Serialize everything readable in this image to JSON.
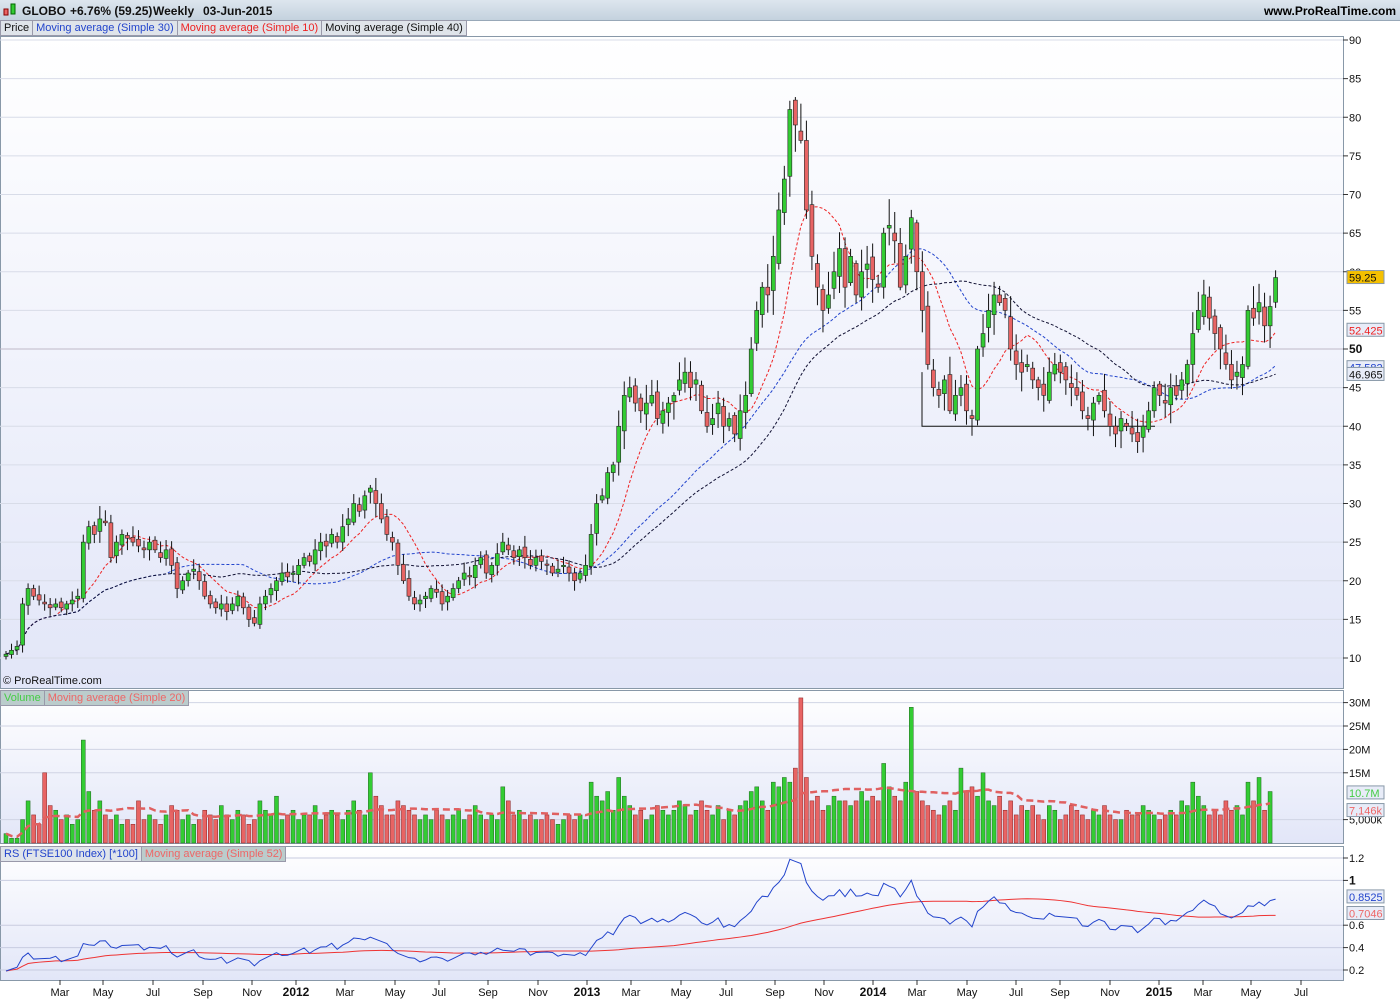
{
  "header": {
    "symbol": "GLOBO",
    "change": "+6.76% (59.25)",
    "period": "Weekly",
    "date": "03-Jun-2015",
    "site": "www.ProRealTime.com"
  },
  "legend_price": [
    "Price",
    "Moving average (Simple 30)",
    "Moving average (Simple 10)",
    "Moving average (Simple 40)"
  ],
  "legend_volume": [
    "Volume",
    "Moving average (Simple 20)"
  ],
  "legend_rs": [
    "RS (FTSE100 Index) [*100]",
    "Moving average (Simple 52)"
  ],
  "copyright": "© ProRealTime.com",
  "colors": {
    "up": "#33cc33",
    "down": "#e86464",
    "ma30": "#2244cc",
    "ma10": "#ee2222",
    "ma40": "#111133",
    "rs": "#2244cc",
    "rsma": "#ee3333"
  },
  "chart_data": [
    {
      "type": "candlestick",
      "title": "GLOBO Weekly",
      "ylim": [
        8,
        92
      ],
      "yticks": [
        10,
        15,
        20,
        25,
        30,
        35,
        40,
        45,
        50,
        55,
        60,
        65,
        70,
        75,
        80,
        85,
        90
      ],
      "closes": [
        10.5,
        11,
        11.5,
        17,
        19,
        18,
        17.5,
        17,
        16.5,
        17,
        16.5,
        17,
        17.5,
        18,
        25,
        27,
        26,
        28,
        27.5,
        23,
        25,
        26,
        25.5,
        25,
        24.5,
        24,
        25,
        24,
        23,
        24,
        22,
        19,
        20,
        21,
        21.5,
        20,
        18,
        17,
        16.5,
        17,
        16,
        17,
        18,
        16.5,
        15,
        14.5,
        17,
        18,
        19,
        20,
        21,
        20.5,
        21,
        22,
        23,
        22.5,
        24,
        25,
        24.5,
        26,
        25,
        27,
        28,
        30,
        29,
        31,
        32,
        30,
        28,
        26,
        25,
        22,
        20,
        18,
        17,
        17.5,
        18,
        19,
        18.5,
        17,
        18,
        19,
        20,
        21,
        20.5,
        22,
        23,
        21,
        22,
        23.5,
        25,
        24,
        23,
        24,
        23,
        22,
        23,
        22.5,
        22,
        21,
        21.5,
        22,
        21,
        20,
        21,
        22,
        26,
        30,
        31,
        34,
        35,
        40,
        44,
        45,
        43,
        42,
        43,
        44,
        41,
        42,
        43,
        44,
        46,
        47,
        45,
        46,
        42,
        40,
        41,
        43,
        40,
        41,
        39,
        42,
        44,
        50,
        55,
        58,
        57,
        62,
        68,
        72,
        81,
        79,
        77,
        68,
        62,
        58,
        55,
        57,
        60,
        63,
        58,
        62,
        57,
        60,
        61,
        59,
        58,
        65,
        66,
        64,
        58,
        62,
        67,
        60,
        55,
        48,
        45,
        44,
        46,
        42,
        44,
        45,
        42,
        41,
        50,
        52,
        55,
        57,
        56,
        55,
        50,
        48,
        47,
        48,
        46,
        45,
        44,
        47,
        48,
        47,
        46,
        45,
        44,
        42,
        41,
        43,
        44,
        42,
        40,
        39,
        41,
        40,
        39,
        38,
        40,
        42,
        45,
        44,
        43,
        45,
        44,
        46,
        48,
        52,
        55,
        57,
        54,
        52,
        50,
        48,
        46,
        47,
        48,
        55,
        54,
        56,
        53,
        55.5,
        59.25
      ],
      "last_labels": {
        "price": "59.25",
        "ma10": "52.425",
        "ma30": "47.582",
        "ma40": "46.965"
      },
      "support_level": 40
    },
    {
      "type": "bar",
      "title": "Volume",
      "yticks": [
        "5,000k",
        "15M",
        "20M",
        "25M",
        "30M"
      ],
      "ytick_values": [
        5,
        15,
        20,
        25,
        30
      ],
      "volumes_millions": [
        2,
        1,
        1,
        5,
        9,
        6,
        4,
        15,
        8,
        7,
        5,
        6,
        4,
        5,
        22,
        11,
        7,
        9,
        6,
        5,
        6,
        4,
        5,
        4,
        9,
        5,
        6,
        5,
        4,
        6,
        8,
        7,
        5,
        6,
        4,
        5,
        7,
        6,
        5,
        8,
        6,
        5,
        7,
        6,
        4,
        5,
        9,
        7,
        6,
        10,
        5,
        6,
        7,
        5,
        6,
        6,
        8,
        5,
        6,
        7,
        6,
        5,
        7,
        9,
        7,
        6,
        15,
        10,
        8,
        6,
        6,
        9,
        8,
        7,
        6,
        5,
        6,
        5,
        7,
        6,
        5,
        6,
        7,
        5,
        6,
        8,
        6,
        5,
        6,
        5,
        12,
        9,
        6,
        7,
        5,
        6,
        5,
        5,
        6,
        5,
        4,
        5,
        6,
        5,
        6,
        5,
        13,
        10,
        9,
        11,
        7,
        14,
        10,
        8,
        6,
        7,
        5,
        6,
        8,
        7,
        6,
        7,
        9,
        8,
        6,
        7,
        9,
        7,
        6,
        8,
        5,
        7,
        6,
        8,
        9,
        11,
        12,
        9,
        7,
        13,
        12,
        14,
        13,
        16,
        31,
        14,
        9,
        10,
        7,
        8,
        10,
        9,
        9,
        8,
        9,
        11,
        9,
        10,
        9,
        17,
        12,
        10,
        9,
        13,
        29,
        11,
        9,
        8,
        7,
        6,
        8,
        9,
        7,
        16,
        11,
        12,
        10,
        15,
        9,
        8,
        10,
        7,
        9,
        6,
        8,
        7,
        8,
        6,
        5,
        8,
        7,
        5,
        6,
        8,
        7,
        6,
        5,
        7,
        6,
        8,
        6,
        5,
        5,
        7,
        6,
        6,
        8,
        7,
        6,
        5,
        6,
        7,
        6,
        9,
        8,
        13,
        10,
        8,
        6,
        7,
        6,
        9,
        7,
        8,
        6,
        13,
        9,
        14,
        7,
        11
      ],
      "last_labels": {
        "volume": "10.7M",
        "ma20": "7,146k"
      }
    },
    {
      "type": "line",
      "title": "RS (FTSE100 Index) [*100]",
      "yticks": [
        "0.2",
        "0.4",
        "0.6",
        "1",
        "1.2"
      ],
      "ytick_values": [
        0.2,
        0.4,
        0.6,
        1,
        1.2
      ],
      "last_labels": {
        "rs": "0.8525",
        "ma52": "0.7046"
      }
    }
  ],
  "xaxis": {
    "labels": [
      "Mar",
      "May",
      "Jul",
      "Sep",
      "Nov",
      "2012",
      "Mar",
      "May",
      "Jul",
      "Sep",
      "Nov",
      "2013",
      "Mar",
      "May",
      "Jul",
      "Sep",
      "Nov",
      "2014",
      "Mar",
      "May",
      "Jul",
      "Sep",
      "Nov",
      "2015",
      "Mar",
      "May",
      "Jul"
    ],
    "bold": [
      "2012",
      "2013",
      "2014",
      "2015"
    ]
  }
}
